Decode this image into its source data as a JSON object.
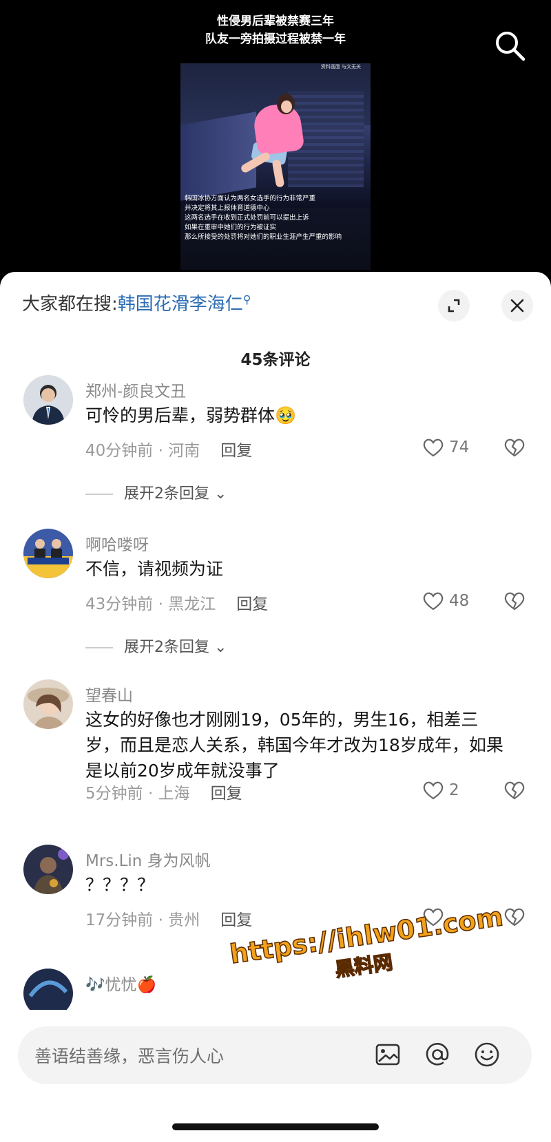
{
  "video": {
    "caption_line1": "性侵男后辈被禁赛三年",
    "caption_line2": "队友一旁拍摄过程被禁一年",
    "source_label": "资料画面 与文无关",
    "subtitles": [
      "韩国冰协方面认为两名女选手的行为非常严重",
      "并决定将其上报体育道德中心",
      "这两名选手在收到正式处罚前可以提出上诉",
      "如果在重审中她们的行为被证实",
      "那么所接受的处罚将对她们的职业生涯产生严重的影响"
    ],
    "search_icon": "search-icon"
  },
  "sheet": {
    "trend_prefix": "大家都在搜:",
    "trend_term": "韩国花滑李海仁",
    "comments_count": "45条评论"
  },
  "comments": [
    {
      "name": "郑州-颜良文丑",
      "text": "可怜的男后辈，弱势群体🥹",
      "time_location": "40分钟前 · 河南",
      "reply_label": "回复",
      "likes": "74",
      "expand": "展开2条回复"
    },
    {
      "name": "啊哈喽呀",
      "text": "不信，请视频为证",
      "time_location": "43分钟前 · 黑龙江",
      "reply_label": "回复",
      "likes": "48",
      "expand": "展开2条回复"
    },
    {
      "name": "望春山",
      "text": "这女的好像也才刚刚19，05年的，男生16，相差三岁，而且是恋人关系，韩国今年才改为18岁成年，如果是以前20岁成年就没事了",
      "time_location": "5分钟前 · 上海",
      "reply_label": "回复",
      "likes": "2"
    },
    {
      "name": "Mrs.Lin 身为风帆",
      "text": "？？？？",
      "time_location": "17分钟前 · 贵州",
      "reply_label": "回复",
      "likes": ""
    },
    {
      "name": "🎶忧忧🍎"
    }
  ],
  "watermark": {
    "url": "https://ihlw01.com",
    "name": "黑料网"
  },
  "input": {
    "placeholder": "善语结善缘，恶言伤人心",
    "icons": [
      "image-icon",
      "at-icon",
      "emoji-icon"
    ]
  },
  "colors": {
    "trend_link": "#2b6cb3",
    "watermark": "#f2a21a"
  }
}
